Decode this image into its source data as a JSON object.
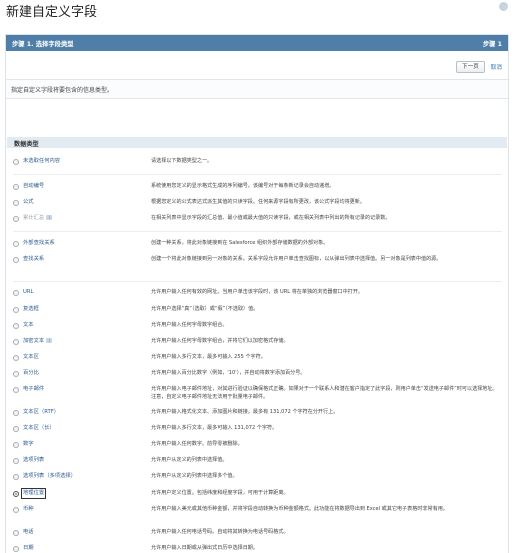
{
  "page": {
    "title": "新建自定义字段"
  },
  "step": {
    "left": "步骤 1. 选择字段类型",
    "right": "步骤 1"
  },
  "buttons": {
    "next": "下一页",
    "cancel": "取消"
  },
  "instruction": "指定自定义字段将要包含的信息类型。",
  "section": {
    "title": "数据类型"
  },
  "types": [
    {
      "label": "未选取任何内容",
      "desc": "请选择以下数据类型之一。",
      "selected": false,
      "disabled": false,
      "info": false
    },
    {
      "label": "自动编号",
      "desc": "系统使用您定义的显示格式生成的序列编号。该编号对于每条新记录会自动递增。",
      "selected": false,
      "disabled": false,
      "info": false
    },
    {
      "label": "公式",
      "desc": "根据您定义的公式表达式派生其值的只读字段。任何来源字段有所更改，该公式字段均将更新。",
      "selected": false,
      "disabled": false,
      "info": false
    },
    {
      "label": "累计汇总",
      "desc": "在相关列表中显示字段的汇总值、最小值或最大值的只读字段，或在相关列表中列出的所有记录的记录数。",
      "selected": false,
      "disabled": true,
      "info": true
    },
    {
      "label": "外部查找关系",
      "desc": "创建一种关系，将此对象链接到在 Salesforce 组织外部存储数据的外部对象。",
      "selected": false,
      "disabled": false,
      "info": false
    },
    {
      "label": "查找关系",
      "desc": "创建一个将此对象链接到另一对象的关系。关系字段允许用户单击查找图标，以从弹出列表中选择值。另一对象是列表中值的源。",
      "selected": false,
      "disabled": false,
      "info": false
    },
    {
      "label": "URL",
      "desc": "允许用户输入任何有效的网址。当用户单击该字段时，该 URL 将在单独的浏览器窗口中打开。",
      "selected": false,
      "disabled": false,
      "info": false
    },
    {
      "label": "复选框",
      "desc": "允许用户选择“真”（选取）或“假”（不选取）值。",
      "selected": false,
      "disabled": false,
      "info": false
    },
    {
      "label": "文本",
      "desc": "允许用户输入任何字母数字组合。",
      "selected": false,
      "disabled": false,
      "info": false
    },
    {
      "label": "加密文本",
      "desc": "允许用户输入任何字母数字组合，并将它们以加密格式存储。",
      "selected": false,
      "disabled": false,
      "info": true
    },
    {
      "label": "文本区",
      "desc": "允许用户输入多行文本，最多可输入 255 个字符。",
      "selected": false,
      "disabled": false,
      "info": false
    },
    {
      "label": "百分比",
      "desc": "允许用户输入百分比数字（例如，'10'），并自动将数字添加百分号。",
      "selected": false,
      "disabled": false,
      "info": false
    },
    {
      "label": "电子邮件",
      "desc": "允许用户输入电子邮件地址，对其进行验证以确保格式正确。如果对于一个联系人和潜在客户指定了此字段，则用户单击“发送电子邮件”时可以选择地址。注意，自定义电子邮件地址无法用于批量电子邮件。",
      "selected": false,
      "disabled": false,
      "info": false
    },
    {
      "label": "文本区（RTF）",
      "desc": "允许用户输入格式化文本、添加图片和链接。最多有 131,072 个字符在分开行上。",
      "selected": false,
      "disabled": false,
      "info": false
    },
    {
      "label": "文本区（长）",
      "desc": "允许用户输入多行文本，最多可输入 131,072 个字符。",
      "selected": false,
      "disabled": false,
      "info": false
    },
    {
      "label": "数字",
      "desc": "允许用户输入任何数字。前导零被删除。",
      "selected": false,
      "disabled": false,
      "info": false
    },
    {
      "label": "选项列表",
      "desc": "允许用户从定义的列表中选择值。",
      "selected": false,
      "disabled": false,
      "info": false
    },
    {
      "label": "选项列表（多项选择）",
      "desc": "允许用户从定义的列表中选择多个值。",
      "selected": false,
      "disabled": false,
      "info": false
    },
    {
      "label": "地理位置",
      "desc": "允许用户定义位置。包括纬度和经度字段，可用于计算距离。",
      "selected": true,
      "disabled": false,
      "info": false
    },
    {
      "label": "币种",
      "desc": "允许用户输入美元或其他币种金额，并将字段自动转换为币种金额格式。此功能在将数据导出到 Excel 或其它电子表格时非常有用。",
      "selected": false,
      "disabled": false,
      "info": false
    },
    {
      "label": "电话",
      "desc": "允许用户输入任何电话号码。自动将其转换为电话号码格式。",
      "selected": false,
      "disabled": false,
      "info": false
    },
    {
      "label": "日期",
      "desc": "允许用户输入日期或从弹出式日历中选择日期。",
      "selected": false,
      "disabled": false,
      "info": false
    },
    {
      "label": "日期/时间",
      "desc": "允许用户输入日期和时间，或从弹出式日历中选择日期。当用户单击弹出式日历中的某个日期后，该日期和当前时间将输入到“日期/时间”字段。",
      "selected": false,
      "disabled": false,
      "info": false
    }
  ]
}
